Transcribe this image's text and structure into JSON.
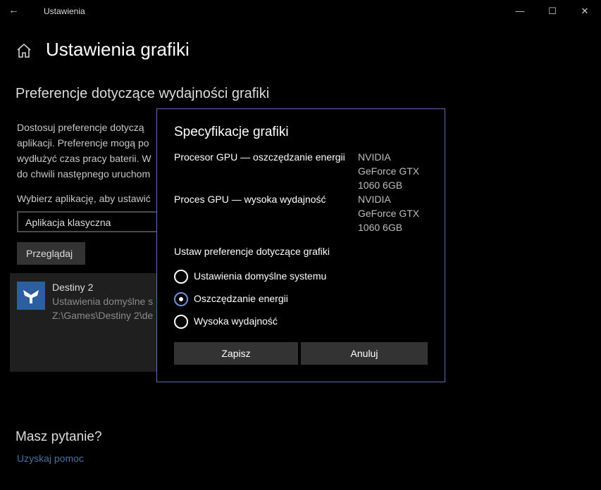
{
  "window": {
    "app_title": "Ustawienia",
    "back_glyph": "←",
    "minimize_glyph": "—",
    "maximize_glyph": "☐",
    "close_glyph": "✕"
  },
  "page": {
    "title": "Ustawienia grafiki",
    "section_title": "Preferencje dotyczące wydajności grafiki",
    "description_lines": [
      "Dostosuj preferencje dotyczą",
      "aplikacji. Preferencje mogą po",
      "wydłużyć czas pracy baterii. W",
      "do chwili następnego uruchom"
    ],
    "choose_label": "Wybierz aplikację, aby ustawić",
    "app_type_value": "Aplikacja klasyczna",
    "browse_label": "Przeglądaj",
    "app_card": {
      "name": "Destiny 2",
      "setting": "Ustawienia domyślne s",
      "path": "Z:\\Games\\Destiny 2\\de"
    },
    "faq_title": "Masz pytanie?",
    "help_link": "Uzyskaj pomoc"
  },
  "dialog": {
    "title": "Specyfikacje grafiki",
    "specs": [
      {
        "label": "Procesor GPU — oszczędzanie energii",
        "value_lines": [
          "NVIDIA",
          "GeForce GTX",
          "1060 6GB"
        ]
      },
      {
        "label": "Proces GPU — wysoka wydajność",
        "value_lines": [
          "NVIDIA",
          "GeForce GTX",
          "1060 6GB"
        ]
      }
    ],
    "preference_label": "Ustaw preferencje dotyczące grafiki",
    "options": [
      {
        "label": "Ustawienia domyślne systemu",
        "checked": false
      },
      {
        "label": "Oszczędzanie energii",
        "checked": true
      },
      {
        "label": "Wysoka wydajność",
        "checked": false
      }
    ],
    "save_label": "Zapisz",
    "cancel_label": "Anuluj"
  },
  "colors": {
    "background": "#000000",
    "accent": "#6f8fd8",
    "dialog_border": "#5a6cb0",
    "link": "#4a6fa0"
  }
}
